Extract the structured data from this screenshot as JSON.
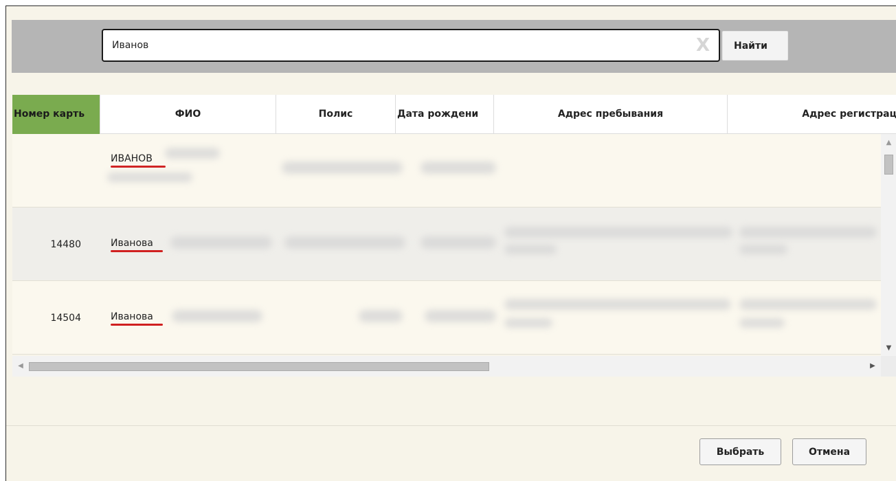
{
  "search": {
    "value": "Иванов",
    "clear_glyph": "X",
    "find_label": "Найти"
  },
  "grid": {
    "columns": [
      {
        "label": "Номер карть",
        "sorted": true
      },
      {
        "label": "ФИО"
      },
      {
        "label": "Полис"
      },
      {
        "label": "Дата рождени"
      },
      {
        "label": "Адрес пребывания"
      },
      {
        "label": "Адрес регистрац"
      }
    ],
    "rows": [
      {
        "card_number": "",
        "surname": "ИВАНОВ"
      },
      {
        "card_number": "14480",
        "surname": "Иванова"
      },
      {
        "card_number": "14504",
        "surname": "Иванова"
      }
    ]
  },
  "footer": {
    "select_label": "Выбрать",
    "cancel_label": "Отмена"
  },
  "colors": {
    "sorted_header": "#7aab4f",
    "search_bar": "#b5b5b5",
    "dialog_bg": "#f7f4e9",
    "highlight_underline": "#d02020"
  },
  "icons": {
    "clear": "close-icon",
    "scroll_up": "arrow-up-icon",
    "scroll_down": "arrow-down-icon",
    "scroll_left": "arrow-left-icon",
    "scroll_right": "arrow-right-icon"
  }
}
